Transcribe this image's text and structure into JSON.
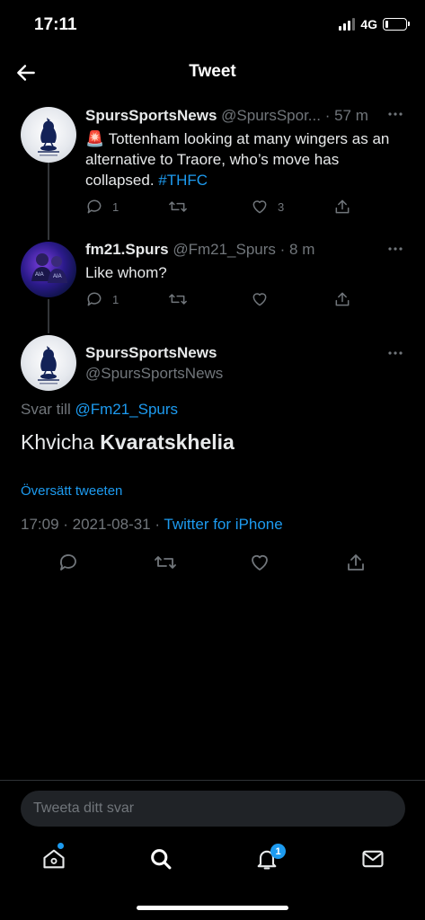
{
  "status_bar": {
    "time": "17:11",
    "network": "4G"
  },
  "header": {
    "title": "Tweet"
  },
  "tweets": [
    {
      "name": "SpursSportsNews",
      "handle": "@SpursSpor...",
      "time": "· 57 m",
      "emoji": "🚨",
      "text": " Tottenham looking at many wingers as an alternative to Traore, who’s move has collapsed. ",
      "hashtag": "#THFC",
      "replies": "1",
      "retweets": "",
      "likes": "3"
    },
    {
      "name": "fm21.Spurs",
      "handle": "@Fm21_Spurs",
      "time": "· 8 m",
      "text": "Like whom?",
      "replies": "1",
      "retweets": "",
      "likes": ""
    }
  ],
  "main_tweet": {
    "name": "SpursSportsNews",
    "handle": "@SpursSportsNews",
    "reply_prefix": "Svar till ",
    "reply_handle": "@Fm21_Spurs",
    "text_plain": "Khvicha ",
    "text_bold": "Kvaratskhelia",
    "translate": "Översätt tweeten",
    "timestamp": "17:09 · 2021-08-31 · ",
    "source": "Twitter for iPhone"
  },
  "reply_box": {
    "placeholder": "Tweeta ditt svar"
  },
  "tabbar": {
    "notifications_badge": "1"
  },
  "colors": {
    "accent": "#1d9bf0",
    "muted": "#71767b",
    "text": "#e7e9ea",
    "background": "#000000"
  }
}
